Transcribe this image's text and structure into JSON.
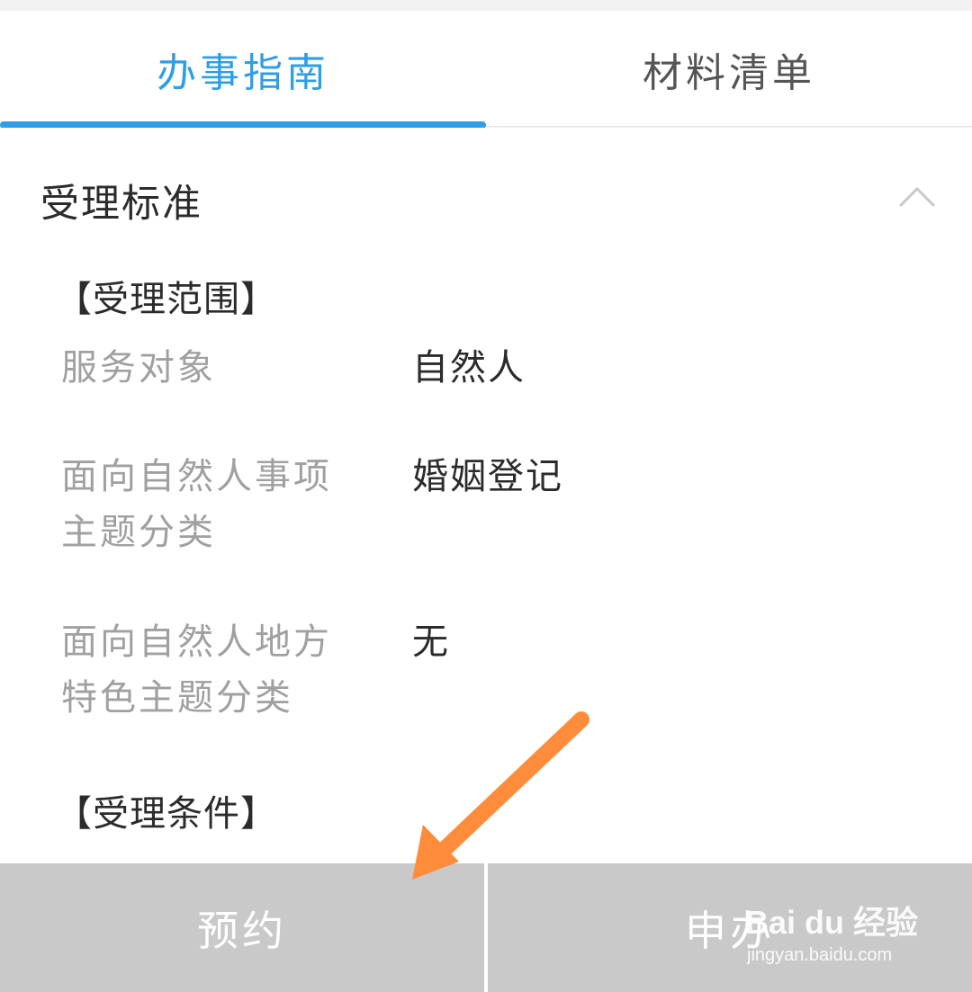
{
  "tabs": [
    {
      "label": "办事指南",
      "active": true
    },
    {
      "label": "材料清单",
      "active": false
    }
  ],
  "section": {
    "title": "受理标准",
    "expanded": true,
    "chevron_icon": "chevron-up-icon"
  },
  "scope": {
    "heading": "【受理范围】",
    "rows": [
      {
        "label": "服务对象",
        "value": "自然人"
      },
      {
        "label": "面向自然人事项主题分类",
        "value": "婚姻登记"
      },
      {
        "label": "面向自然人地方特色主题分类",
        "value": "无"
      }
    ]
  },
  "conditions": {
    "heading": "【受理条件】"
  },
  "footer": {
    "reserve_label": "预约",
    "apply_label": "申办"
  },
  "watermark": {
    "brand": "Bai du 经验",
    "url": "jingyan.baidu.com"
  },
  "colors": {
    "accent": "#2e9ee6",
    "arrow": "#ff8c3a",
    "footer_bg": "#c9c9c9"
  }
}
